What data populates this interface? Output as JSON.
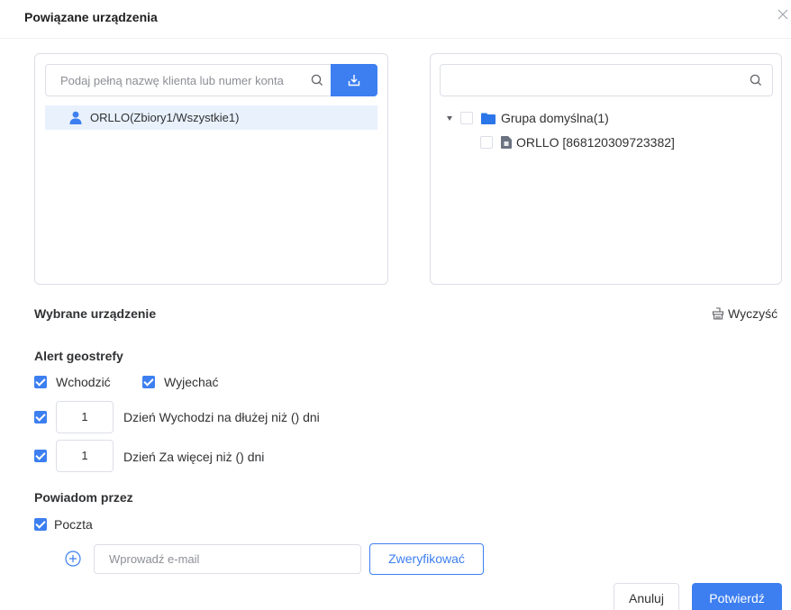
{
  "dialog": {
    "title": "Powiązane urządzenia",
    "close_icon": "close-icon"
  },
  "left_panel": {
    "search_placeholder": "Podaj pełną nazwę klienta lub numer konta",
    "search_icon": "search-icon",
    "import_icon": "import-icon",
    "result_item": {
      "icon": "user-icon",
      "label": "ORLLO(Zbiory1/Wszystkie1)"
    }
  },
  "right_panel": {
    "search_placeholder": "",
    "search_icon": "search-icon",
    "tree": {
      "group": {
        "label": "Grupa domyślna(1)",
        "expanded": true,
        "checked": false,
        "icon": "folder-icon"
      },
      "device": {
        "label": "ORLLO [868120309723382]",
        "checked": false,
        "icon": "device-icon"
      }
    }
  },
  "selected": {
    "title": "Wybrane urządzenie",
    "clear_label": "Wyczyść",
    "clear_icon": "clear-icon"
  },
  "geofence": {
    "title": "Alert geostrefy",
    "enter_label": "Wchodzić",
    "enter_checked": true,
    "exit_label": "Wyjechać",
    "exit_checked": true,
    "rule1": {
      "checked": true,
      "value": "1",
      "text": "Dzień Wychodzi na dłużej niż () dni"
    },
    "rule2": {
      "checked": true,
      "value": "1",
      "text": "Dzień Za więcej niż () dni"
    }
  },
  "notify": {
    "title": "Powiadom przez",
    "mail_label": "Poczta",
    "mail_checked": true,
    "add_icon": "plus-circle-icon",
    "email_placeholder": "Wprowadź e-mail",
    "verify_label": "Zweryfikować"
  },
  "footer": {
    "cancel_label": "Anuluj",
    "confirm_label": "Potwierdź"
  },
  "colors": {
    "primary": "#3d7ff0",
    "selected_bg": "#e8f1fc",
    "border": "#dcdfe6",
    "folder": "#2b76e8",
    "device_icon": "#6b7280"
  }
}
